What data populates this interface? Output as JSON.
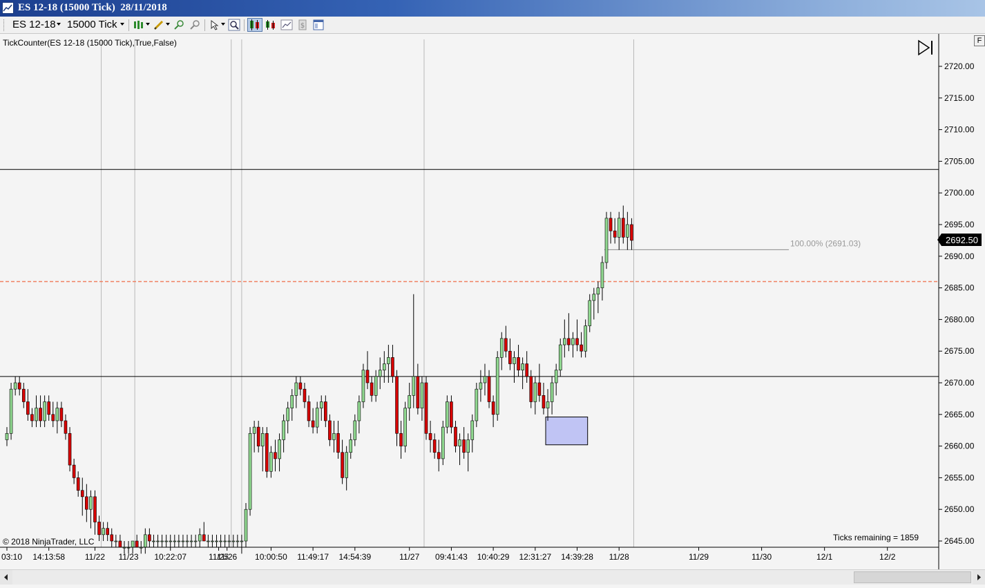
{
  "window": {
    "title": "ES 12-18 (15000 Tick)  28/11/2018"
  },
  "toolbar": {
    "instrument": "ES 12-18",
    "interval": "15000 Tick",
    "icons": [
      "bars-type-icon",
      "drawing-pencil-icon",
      "zoom-in-icon",
      "zoom-out-icon",
      "cursor-pointer-icon",
      "search-icon",
      "bar-chart-toggle-icon",
      "candlestick-icon",
      "line-chart-icon",
      "data-box-icon",
      "properties-icon"
    ]
  },
  "indicator_label": "TickCounter(ES  12-18 (15000  Tick),True,False)",
  "ticks_remaining": "Ticks remaining = 1859",
  "copyright": "© 2018 NinjaTrader, LLC",
  "last_price": "2692.50",
  "fib_label": "100.00% (2691.03)",
  "scroll_right_button": "F",
  "colors": {
    "up": "#90d890",
    "down": "#d80000",
    "background": "#f4f4f4",
    "last_price_bg": "#000000",
    "dashed_line": "#f08060",
    "rectangle": "#c0c4f4"
  },
  "chart_data": {
    "type": "candlestick",
    "instrument": "ES 12-18",
    "interval": "15000 Tick",
    "y_axis": {
      "ticks": [
        "2720.00",
        "2715.00",
        "2710.00",
        "2705.00",
        "2700.00",
        "2695.00",
        "2690.00",
        "2685.00",
        "2680.00",
        "2675.00",
        "2670.00",
        "2665.00",
        "2660.00",
        "2655.00",
        "2650.00",
        "2645.00"
      ],
      "range": [
        2644,
        2723
      ]
    },
    "x_axis": {
      "labels": [
        {
          "t": "03:10",
          "bar": 0
        },
        {
          "t": "14:13:58",
          "bar": 10
        },
        {
          "t": "11/22",
          "bar": 21
        },
        {
          "t": "11/23",
          "bar": 29
        },
        {
          "t": "10:22:07",
          "bar": 39
        },
        {
          "t": "11/25",
          "bar": 50.5
        },
        {
          "t": "11/26",
          "bar": 52.5
        },
        {
          "t": "10:00:50",
          "bar": 63
        },
        {
          "t": "11:49:17",
          "bar": 73
        },
        {
          "t": "14:54:39",
          "bar": 83
        },
        {
          "t": "11/27",
          "bar": 96
        },
        {
          "t": "09:41:43",
          "bar": 106
        },
        {
          "t": "10:40:29",
          "bar": 116
        },
        {
          "t": "12:31:27",
          "bar": 126
        },
        {
          "t": "14:39:28",
          "bar": 136
        },
        {
          "t": "11/28",
          "bar": 146
        },
        {
          "t": "11/29",
          "bar": 165
        },
        {
          "t": "11/30",
          "bar": 180
        },
        {
          "t": "12/1",
          "bar": 195
        },
        {
          "t": "12/2",
          "bar": 210
        }
      ],
      "session_break_bars": [
        22.5,
        30.5,
        53.5,
        56,
        99.5,
        149.5
      ]
    },
    "horizontal_lines": [
      {
        "price": 2703.7,
        "style": "solid"
      },
      {
        "price": 2671.0,
        "style": "solid"
      },
      {
        "price": 2686.0,
        "style": "dashed"
      }
    ],
    "fib_line": {
      "price": 2691.03,
      "from_bar": 142.5,
      "to_bar": 186.5,
      "label": "100.00% (2691.03)"
    },
    "rectangle": {
      "from_bar": 128.5,
      "to_bar": 138.5,
      "top": 2664.6,
      "bottom": 2660.2
    },
    "current_price": 2692.5,
    "bars": [
      [
        2661,
        2663,
        2660,
        2662
      ],
      [
        2662,
        2670,
        2661,
        2669
      ],
      [
        2669,
        2671,
        2668,
        2670
      ],
      [
        2670,
        2671,
        2668,
        2669
      ],
      [
        2669,
        2670,
        2666,
        2667
      ],
      [
        2667,
        2669,
        2664,
        2665
      ],
      [
        2665,
        2666,
        2663,
        2664
      ],
      [
        2664,
        2668,
        2663,
        2666
      ],
      [
        2666,
        2668,
        2663,
        2664
      ],
      [
        2664,
        2668,
        2663,
        2667
      ],
      [
        2667,
        2668,
        2664,
        2665
      ],
      [
        2665,
        2667,
        2663,
        2664
      ],
      [
        2664,
        2667,
        2662,
        2666
      ],
      [
        2666,
        2667,
        2663,
        2664
      ],
      [
        2664,
        2665,
        2661,
        2662
      ],
      [
        2662,
        2663,
        2656,
        2657
      ],
      [
        2657,
        2658,
        2654,
        2655
      ],
      [
        2655,
        2656,
        2652,
        2653
      ],
      [
        2653,
        2655,
        2649,
        2652
      ],
      [
        2652,
        2654,
        2648,
        2650
      ],
      [
        2650,
        2653,
        2647,
        2652
      ],
      [
        2652,
        2653,
        2646,
        2648
      ],
      [
        2648,
        2649,
        2645,
        2646
      ],
      [
        2646,
        2648,
        2645,
        2647
      ],
      [
        2647,
        2648,
        2645,
        2646
      ],
      [
        2646,
        2647,
        2644,
        2645
      ],
      [
        2645,
        2646,
        2644,
        2645
      ],
      [
        2645,
        2646,
        2644,
        2644
      ],
      [
        2644,
        2645,
        2643,
        2644
      ],
      [
        2644,
        2645,
        2643,
        2644
      ],
      [
        2644,
        2645,
        2643,
        2645
      ],
      [
        2645,
        2646,
        2644,
        2644
      ],
      [
        2644,
        2645,
        2643,
        2644
      ],
      [
        2644,
        2647,
        2643,
        2646
      ],
      [
        2646,
        2647,
        2644,
        2645
      ],
      [
        2645,
        2646,
        2644,
        2645
      ],
      [
        2645,
        2646,
        2644,
        2645
      ],
      [
        2645,
        2646,
        2644,
        2645
      ],
      [
        2645,
        2646,
        2644,
        2645
      ],
      [
        2645,
        2646,
        2644,
        2645
      ],
      [
        2645,
        2646,
        2644,
        2645
      ],
      [
        2645,
        2646,
        2644,
        2645
      ],
      [
        2645,
        2646,
        2644,
        2645
      ],
      [
        2645,
        2646,
        2644,
        2645
      ],
      [
        2645,
        2646,
        2644,
        2645
      ],
      [
        2645,
        2646,
        2644,
        2645
      ],
      [
        2645,
        2647,
        2644,
        2646
      ],
      [
        2646,
        2648,
        2645,
        2645
      ],
      [
        2645,
        2646,
        2644,
        2645
      ],
      [
        2645,
        2646,
        2644,
        2645
      ],
      [
        2645,
        2646,
        2644,
        2645
      ],
      [
        2645,
        2646,
        2644,
        2645
      ],
      [
        2645,
        2646,
        2644,
        2645
      ],
      [
        2645,
        2646,
        2644,
        2645
      ],
      [
        2645,
        2646,
        2644,
        2645
      ],
      [
        2645,
        2646,
        2644,
        2645
      ],
      [
        2645,
        2646,
        2643,
        2645
      ],
      [
        2645,
        2651,
        2644,
        2650
      ],
      [
        2650,
        2663,
        2649,
        2662
      ],
      [
        2662,
        2664,
        2659,
        2663
      ],
      [
        2663,
        2664,
        2659,
        2660
      ],
      [
        2660,
        2663,
        2656,
        2662
      ],
      [
        2662,
        2663,
        2655,
        2656
      ],
      [
        2656,
        2660,
        2655,
        2659
      ],
      [
        2659,
        2661,
        2656,
        2658
      ],
      [
        2658,
        2662,
        2656,
        2661
      ],
      [
        2661,
        2665,
        2659,
        2664
      ],
      [
        2664,
        2667,
        2662,
        2666
      ],
      [
        2666,
        2669,
        2664,
        2668
      ],
      [
        2668,
        2671,
        2666,
        2670
      ],
      [
        2670,
        2671,
        2668,
        2669
      ],
      [
        2669,
        2670,
        2666,
        2667
      ],
      [
        2667,
        2668,
        2663,
        2664
      ],
      [
        2664,
        2666,
        2662,
        2663
      ],
      [
        2663,
        2667,
        2662,
        2666
      ],
      [
        2666,
        2668,
        2664,
        2667
      ],
      [
        2667,
        2668,
        2663,
        2664
      ],
      [
        2664,
        2665,
        2660,
        2661
      ],
      [
        2661,
        2664,
        2659,
        2662
      ],
      [
        2662,
        2664,
        2658,
        2659
      ],
      [
        2659,
        2661,
        2654,
        2655
      ],
      [
        2655,
        2660,
        2653,
        2659
      ],
      [
        2659,
        2662,
        2658,
        2661
      ],
      [
        2661,
        2665,
        2660,
        2664
      ],
      [
        2664,
        2668,
        2662,
        2667
      ],
      [
        2667,
        2673,
        2666,
        2672
      ],
      [
        2672,
        2675,
        2669,
        2670
      ],
      [
        2670,
        2671,
        2667,
        2668
      ],
      [
        2668,
        2672,
        2667,
        2671
      ],
      [
        2671,
        2674,
        2669,
        2672
      ],
      [
        2672,
        2675,
        2670,
        2673
      ],
      [
        2673,
        2676,
        2670,
        2674
      ],
      [
        2674,
        2676,
        2670,
        2671
      ],
      [
        2671,
        2672,
        2660,
        2662
      ],
      [
        2662,
        2664,
        2658,
        2660
      ],
      [
        2660,
        2667,
        2659,
        2666
      ],
      [
        2666,
        2670,
        2664,
        2668
      ],
      [
        2668,
        2684,
        2666,
        2671
      ],
      [
        2671,
        2673,
        2665,
        2666
      ],
      [
        2666,
        2671,
        2664,
        2670
      ],
      [
        2670,
        2671,
        2661,
        2662
      ],
      [
        2662,
        2664,
        2659,
        2661
      ],
      [
        2661,
        2662,
        2658,
        2659
      ],
      [
        2659,
        2661,
        2656,
        2658
      ],
      [
        2658,
        2664,
        2657,
        2663
      ],
      [
        2663,
        2668,
        2662,
        2667
      ],
      [
        2667,
        2668,
        2662,
        2663
      ],
      [
        2663,
        2664,
        2659,
        2660
      ],
      [
        2660,
        2662,
        2657,
        2661
      ],
      [
        2661,
        2663,
        2658,
        2659
      ],
      [
        2659,
        2662,
        2656,
        2661
      ],
      [
        2661,
        2665,
        2659,
        2664
      ],
      [
        2664,
        2670,
        2663,
        2669
      ],
      [
        2669,
        2672,
        2667,
        2670
      ],
      [
        2670,
        2673,
        2668,
        2671
      ],
      [
        2671,
        2672,
        2666,
        2667
      ],
      [
        2667,
        2668,
        2663,
        2665
      ],
      [
        2665,
        2675,
        2664,
        2674
      ],
      [
        2674,
        2678,
        2672,
        2677
      ],
      [
        2677,
        2679,
        2674,
        2675
      ],
      [
        2675,
        2677,
        2672,
        2673
      ],
      [
        2673,
        2675,
        2670,
        2674
      ],
      [
        2674,
        2676,
        2671,
        2672
      ],
      [
        2672,
        2674,
        2669,
        2673
      ],
      [
        2673,
        2675,
        2670,
        2671
      ],
      [
        2671,
        2672,
        2666,
        2667
      ],
      [
        2667,
        2671,
        2665,
        2670
      ],
      [
        2670,
        2673,
        2667,
        2668
      ],
      [
        2668,
        2670,
        2665,
        2666
      ],
      [
        2666,
        2669,
        2664,
        2667
      ],
      [
        2667,
        2671,
        2665,
        2670
      ],
      [
        2670,
        2673,
        2668,
        2672
      ],
      [
        2672,
        2677,
        2671,
        2676
      ],
      [
        2676,
        2680,
        2674,
        2677
      ],
      [
        2677,
        2681,
        2675,
        2676
      ],
      [
        2676,
        2678,
        2674,
        2677
      ],
      [
        2677,
        2680,
        2675,
        2676
      ],
      [
        2676,
        2678,
        2674,
        2675
      ],
      [
        2675,
        2680,
        2674,
        2679
      ],
      [
        2679,
        2684,
        2678,
        2683
      ],
      [
        2683,
        2685,
        2680,
        2684
      ],
      [
        2684,
        2686,
        2681,
        2685
      ],
      [
        2685,
        2690,
        2683,
        2689
      ],
      [
        2689,
        2697,
        2688,
        2696
      ],
      [
        2696,
        2697,
        2692,
        2694
      ],
      [
        2694,
        2696,
        2692,
        2693
      ],
      [
        2693,
        2697,
        2691,
        2696
      ],
      [
        2696,
        2698,
        2692,
        2693
      ],
      [
        2693,
        2697,
        2691,
        2695
      ],
      [
        2695,
        2696,
        2691,
        2692.5
      ]
    ]
  }
}
